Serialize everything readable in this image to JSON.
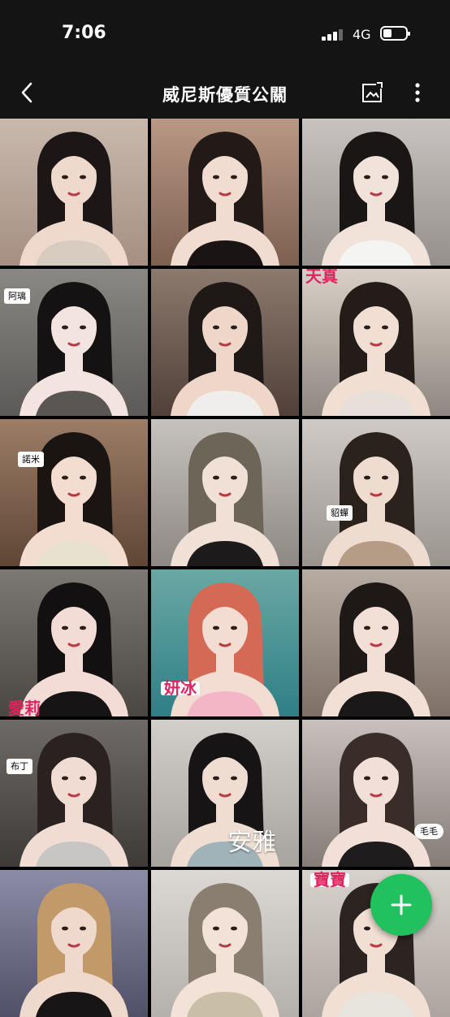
{
  "status_bar": {
    "time": "7:06",
    "network": "4G",
    "icons": [
      "signal-icon",
      "battery-icon"
    ]
  },
  "header": {
    "title": "威尼斯優質公關",
    "back_icon": "chevron-left-icon",
    "album_icon": "album-icon",
    "more_icon": "more-vertical-icon"
  },
  "grid": {
    "photos": [
      {
        "label": ""
      },
      {
        "label": ""
      },
      {
        "label": ""
      },
      {
        "label": "阿璃"
      },
      {
        "label": ""
      },
      {
        "label": "天真"
      },
      {
        "label": "諾米"
      },
      {
        "label": ""
      },
      {
        "label": "貂蟬"
      },
      {
        "label": "愛莉"
      },
      {
        "label": "妍冰"
      },
      {
        "label": ""
      },
      {
        "label": "布丁"
      },
      {
        "label": "安雅"
      },
      {
        "label": "毛毛"
      },
      {
        "label": ""
      },
      {
        "label": ""
      },
      {
        "label": "寶寶"
      }
    ]
  },
  "fab": {
    "icon": "plus-icon",
    "color": "#21c25e"
  }
}
